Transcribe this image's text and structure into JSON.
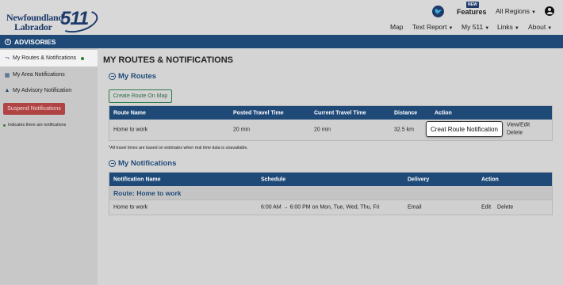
{
  "header": {
    "logo_line1": "Newfoundland",
    "logo_line2": "Labrador",
    "logo_511": "511",
    "new_badge": "NEW",
    "features": "Features",
    "regions": "All Regions",
    "nav": [
      {
        "label": "Map"
      },
      {
        "label": "Text Report"
      },
      {
        "label": "My 511"
      },
      {
        "label": "Links"
      },
      {
        "label": "About"
      }
    ]
  },
  "advisories": {
    "label": "ADVISORIES"
  },
  "sidebar": {
    "items": [
      {
        "label": "My Routes & Notifications",
        "icon": "route-icon"
      },
      {
        "label": "My Area Notifications",
        "icon": "map-icon"
      },
      {
        "label": "My Advisory Notification",
        "icon": "warning-icon"
      }
    ],
    "suspend_label": "Suspend Notifications",
    "indicates_label": "Indicates there are notifications"
  },
  "main": {
    "title": "MY ROUTES & NOTIFICATIONS",
    "routes_heading": "My Routes",
    "create_route": "Create Route On Map",
    "routes_table": {
      "headers": [
        "Route Name",
        "Posted Travel Time",
        "Current Travel Time",
        "Distance",
        "Action"
      ],
      "rows": [
        {
          "name": "Home to work",
          "posted": "20 min",
          "current": "20 min",
          "distance": "32.5 km",
          "action1": "View/Edit",
          "action2": "Delete"
        }
      ]
    },
    "note": "*All travel times are based on estimates when real time data is unavailable.",
    "notifications_heading": "My Notifications",
    "notif_table": {
      "headers": [
        "Notification Name",
        "Schedule",
        "Delivery",
        "Action"
      ],
      "group": "Route: Home to work",
      "rows": [
        {
          "name": "Home to work",
          "schedule": "6:00 AM → 6:00 PM on Mon, Tue, Wed, Thu, Fri",
          "delivery": "Email",
          "edit": "Edit",
          "delete": "Delete"
        }
      ]
    },
    "tooltip": "Creat Route Notification"
  },
  "colors": {
    "primary": "#1f4a78",
    "suspend": "#b04343",
    "green": "#2e7d32"
  }
}
